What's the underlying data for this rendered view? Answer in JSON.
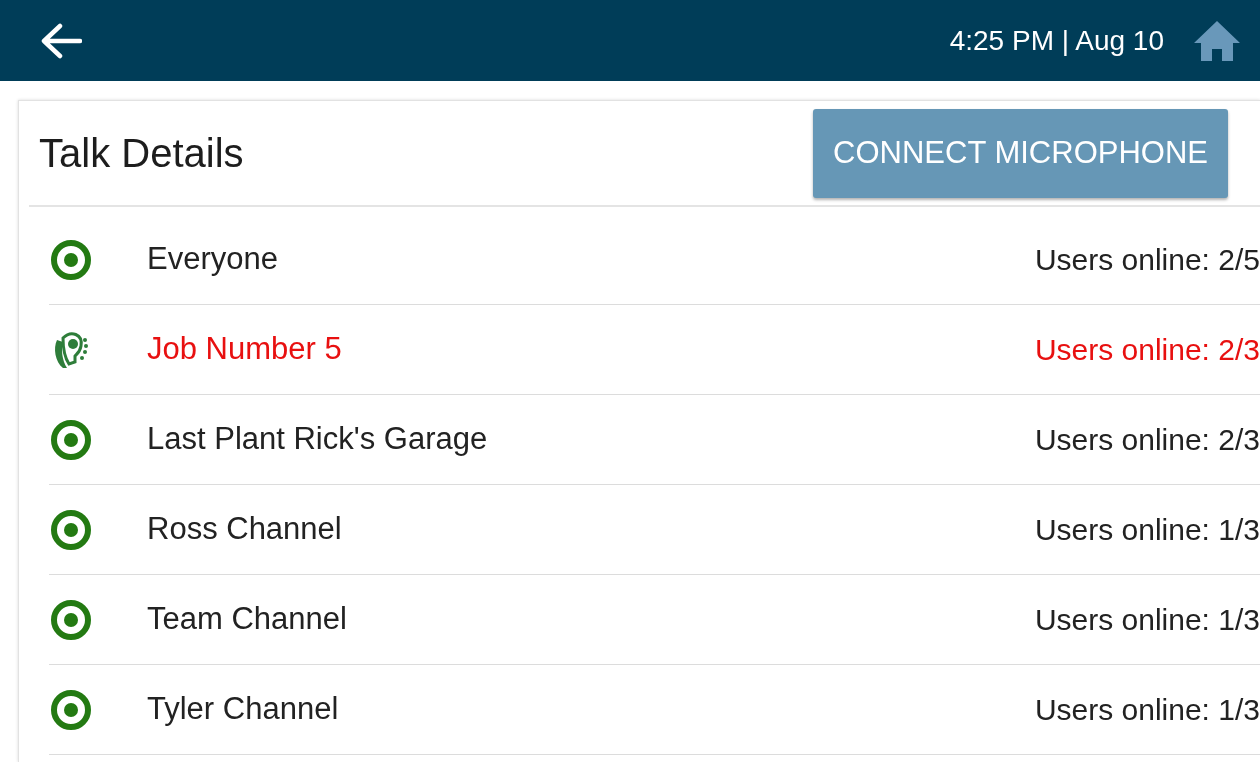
{
  "header": {
    "time": "4:25 PM | Aug 10"
  },
  "panel": {
    "title": "Talk Details",
    "button": "CONNECT MICROPHONE"
  },
  "channels": [
    {
      "name": "Everyone",
      "users": "Users online: 2/5",
      "active": false
    },
    {
      "name": "Job Number 5",
      "users": "Users online: 2/3",
      "active": true
    },
    {
      "name": "Last Plant Rick's Garage",
      "users": "Users online: 2/3",
      "active": false
    },
    {
      "name": "Ross Channel",
      "users": "Users online: 1/3",
      "active": false
    },
    {
      "name": "Team Channel",
      "users": "Users online: 1/3",
      "active": false
    },
    {
      "name": "Tyler Channel",
      "users": "Users online: 1/3",
      "active": false
    }
  ]
}
